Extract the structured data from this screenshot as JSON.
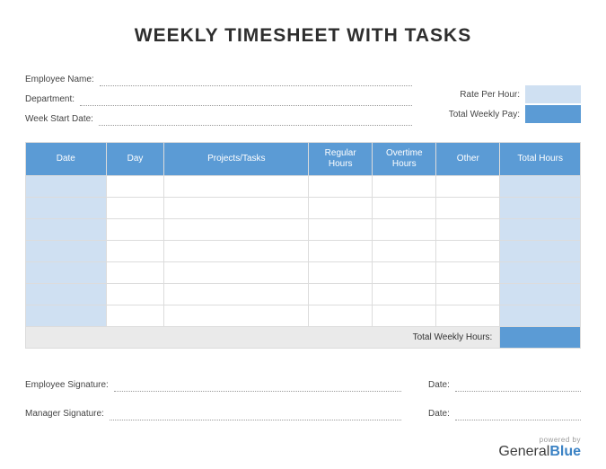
{
  "title": "WEEKLY TIMESHEET WITH TASKS",
  "fields": {
    "employee_name": "Employee Name:",
    "department": "Department:",
    "week_start": "Week Start Date:",
    "rate_per_hour": "Rate Per Hour:",
    "total_weekly_pay": "Total Weekly Pay:"
  },
  "columns": {
    "date": "Date",
    "day": "Day",
    "projects": "Projects/Tasks",
    "regular": "Regular Hours",
    "overtime": "Overtime Hours",
    "other": "Other",
    "total": "Total Hours"
  },
  "rows": 7,
  "totals_label": "Total Weekly Hours:",
  "signatures": {
    "employee": "Employee Signature:",
    "manager": "Manager Signature:",
    "date": "Date:"
  },
  "footer": {
    "powered": "powered by",
    "brand_a": "General",
    "brand_b": "Blue"
  }
}
